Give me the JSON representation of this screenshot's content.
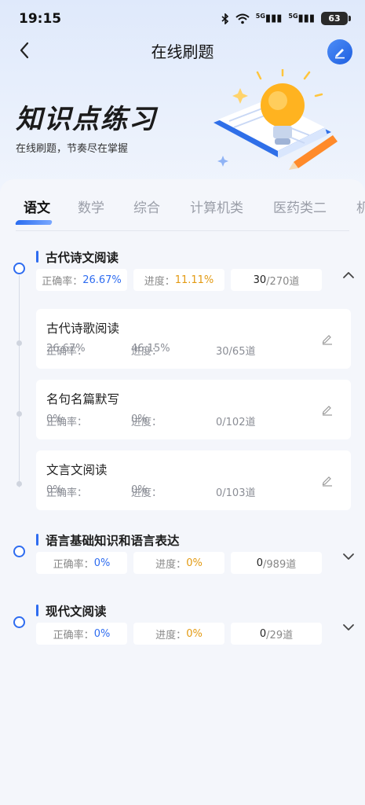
{
  "status_bar": {
    "time": "19:15",
    "signal1": "5G",
    "signal2": "5G",
    "battery": "63"
  },
  "nav": {
    "title": "在线刷题"
  },
  "hero": {
    "title": "知识点练习",
    "subtitle": "在线刷题，节奏尽在掌握"
  },
  "tabs": [
    {
      "label": "语文",
      "active": true
    },
    {
      "label": "数学",
      "active": false
    },
    {
      "label": "综合",
      "active": false
    },
    {
      "label": "计算机类",
      "active": false
    },
    {
      "label": "医药类二",
      "active": false
    },
    {
      "label": "机",
      "active": false
    }
  ],
  "labels": {
    "accuracy": "正确率：",
    "progress": "进度："
  },
  "sections": [
    {
      "title": "古代诗文阅读",
      "accuracy": "26.67%",
      "progress": "11.11%",
      "done": "30",
      "total": "/270道",
      "expanded": true,
      "items": [
        {
          "title": "古代诗歌阅读",
          "accuracy": "26.67%",
          "progress": "46.15%",
          "count": "30/65道"
        },
        {
          "title": "名句名篇默写",
          "accuracy": "0%",
          "progress": "0%",
          "count": "0/102道"
        },
        {
          "title": "文言文阅读",
          "accuracy": "0%",
          "progress": "0%",
          "count": "0/103道"
        }
      ]
    },
    {
      "title": "语言基础知识和语言表达",
      "accuracy": "0%",
      "progress": "0%",
      "done": "0",
      "total": "/989道",
      "expanded": false
    },
    {
      "title": "现代文阅读",
      "accuracy": "0%",
      "progress": "0%",
      "done": "0",
      "total": "/29道",
      "expanded": false
    }
  ],
  "colors": {
    "accent": "#2e6cf0",
    "progress": "#e39a12"
  }
}
